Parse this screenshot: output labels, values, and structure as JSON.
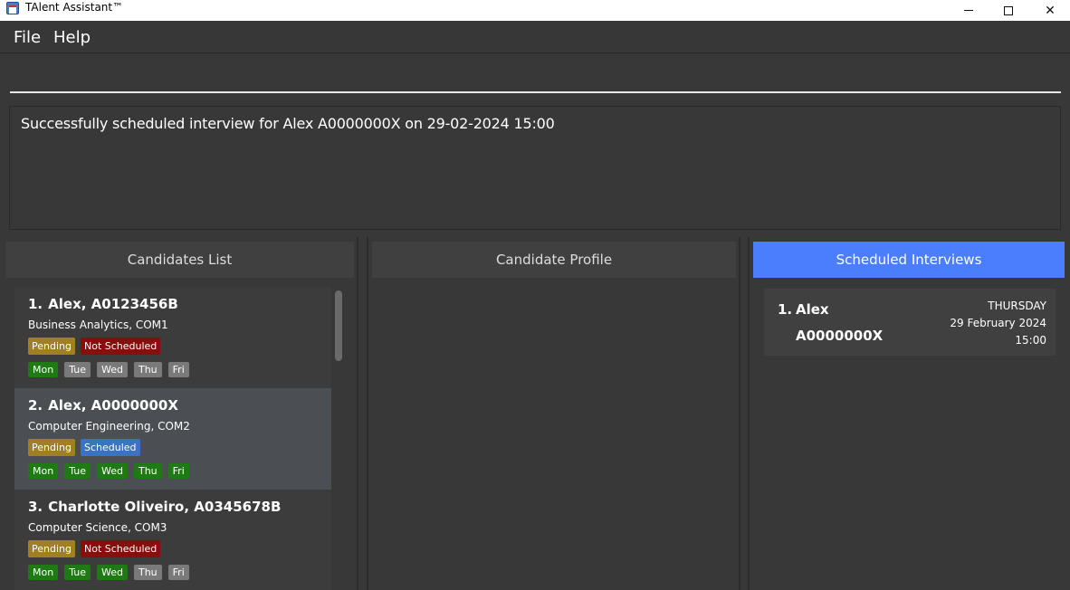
{
  "window": {
    "title": "TAlent Assistant™",
    "app_icon": "calendar-icon"
  },
  "menu": {
    "file": "File",
    "help": "Help"
  },
  "command": {
    "value": "",
    "placeholder": ""
  },
  "result": {
    "message": "Successfully scheduled interview for Alex A0000000X on 29-02-2024 15:00"
  },
  "panels": {
    "candidates_title": "Candidates List",
    "profile_title": "Candidate Profile",
    "interviews_title": "Scheduled Interviews"
  },
  "candidates": [
    {
      "index": "1.",
      "name": "Alex, A0123456B",
      "dept": "Business Analytics, COM1",
      "status": "Pending",
      "schedule": "Not Scheduled",
      "days": [
        {
          "label": "Mon",
          "available": true
        },
        {
          "label": "Tue",
          "available": false
        },
        {
          "label": "Wed",
          "available": false
        },
        {
          "label": "Thu",
          "available": false
        },
        {
          "label": "Fri",
          "available": false
        }
      ]
    },
    {
      "index": "2.",
      "name": "Alex, A0000000X",
      "dept": "Computer Engineering, COM2",
      "status": "Pending",
      "schedule": "Scheduled",
      "days": [
        {
          "label": "Mon",
          "available": true
        },
        {
          "label": "Tue",
          "available": true
        },
        {
          "label": "Wed",
          "available": true
        },
        {
          "label": "Thu",
          "available": true
        },
        {
          "label": "Fri",
          "available": true
        }
      ]
    },
    {
      "index": "3.",
      "name": "Charlotte Oliveiro, A0345678B",
      "dept": "Computer Science, COM3",
      "status": "Pending",
      "schedule": "Not Scheduled",
      "days": [
        {
          "label": "Mon",
          "available": true
        },
        {
          "label": "Tue",
          "available": true
        },
        {
          "label": "Wed",
          "available": true
        },
        {
          "label": "Thu",
          "available": false
        },
        {
          "label": "Fri",
          "available": false
        }
      ]
    }
  ],
  "interviews": [
    {
      "index": "1.",
      "name": "Alex",
      "id": "A0000000X",
      "day": "THURSDAY",
      "date": "29 February 2024",
      "time": "15:00"
    }
  ],
  "colors": {
    "accent": "#4a7efc",
    "pending": "#a08020",
    "not_scheduled": "#8b0c0c",
    "scheduled": "#3a72c4",
    "day_available": "#1e7a12",
    "day_unavailable": "#7a7a7a"
  }
}
